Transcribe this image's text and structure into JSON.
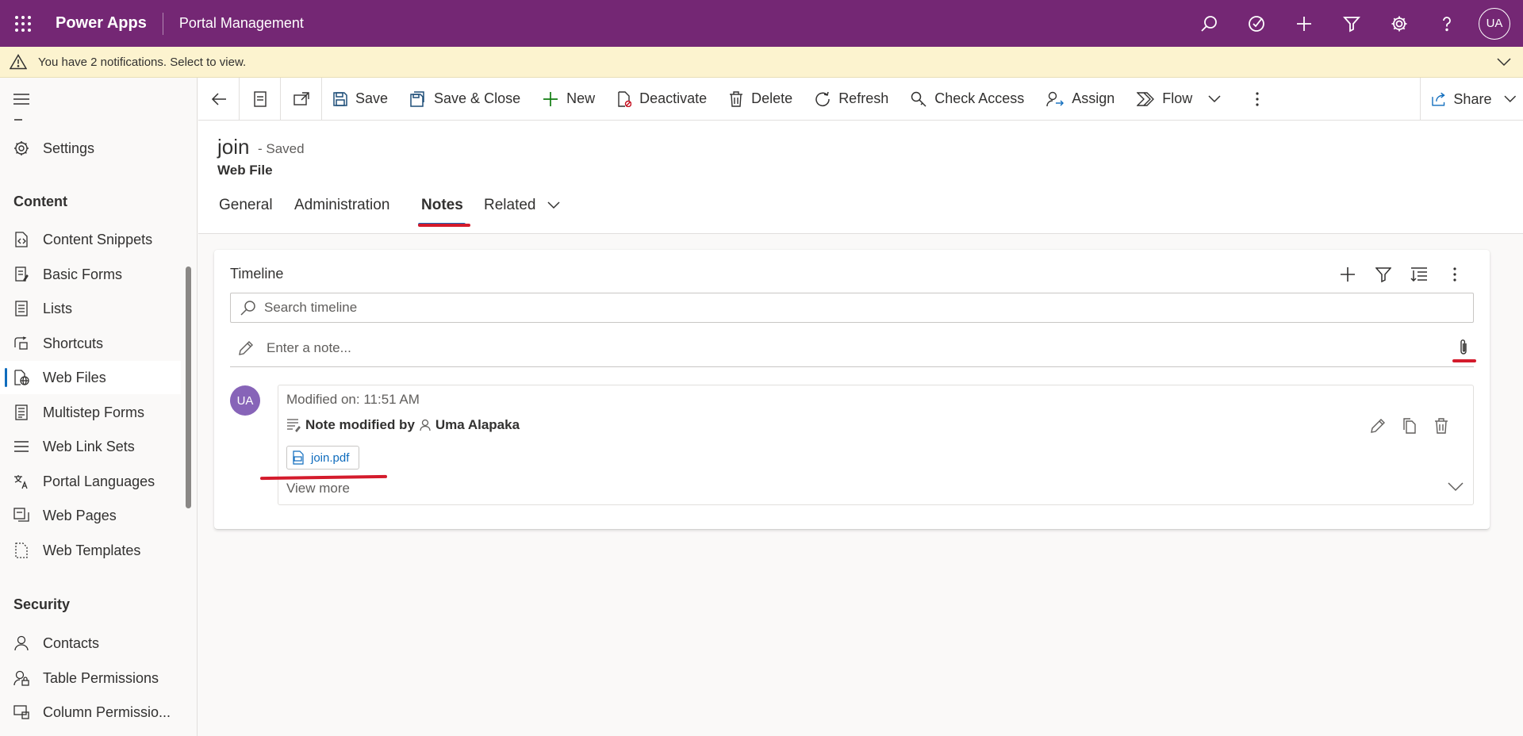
{
  "header": {
    "app_name": "Power Apps",
    "app_subtitle": "Portal Management",
    "user_initials": "UA",
    "icons": [
      "search-icon",
      "task-icon",
      "add-icon",
      "filter-icon",
      "settings-icon",
      "help-icon"
    ]
  },
  "notification": {
    "text": "You have 2 notifications. Select to view."
  },
  "sidebar": {
    "settings_label": "Settings",
    "content_header": "Content",
    "content_items": [
      {
        "label": "Content Snippets",
        "icon": "snippet-icon"
      },
      {
        "label": "Basic Forms",
        "icon": "form-icon"
      },
      {
        "label": "Lists",
        "icon": "list-icon"
      },
      {
        "label": "Shortcuts",
        "icon": "shortcut-icon"
      },
      {
        "label": "Web Files",
        "icon": "web-file-icon",
        "active": true
      },
      {
        "label": "Multistep Forms",
        "icon": "multistep-form-icon"
      },
      {
        "label": "Web Link Sets",
        "icon": "link-set-icon"
      },
      {
        "label": "Portal Languages",
        "icon": "language-icon"
      },
      {
        "label": "Web Pages",
        "icon": "web-page-icon"
      },
      {
        "label": "Web Templates",
        "icon": "template-icon"
      }
    ],
    "security_header": "Security",
    "security_items": [
      {
        "label": "Contacts",
        "icon": "contact-icon"
      },
      {
        "label": "Table Permissions",
        "icon": "table-permission-icon"
      },
      {
        "label": "Column Permissio...",
        "icon": "column-permission-icon"
      }
    ]
  },
  "commandbar": {
    "save": "Save",
    "save_close": "Save & Close",
    "new": "New",
    "deactivate": "Deactivate",
    "delete": "Delete",
    "refresh": "Refresh",
    "check_access": "Check Access",
    "assign": "Assign",
    "flow": "Flow",
    "share": "Share"
  },
  "record": {
    "title": "join",
    "status": "- Saved",
    "entity": "Web File"
  },
  "tabs": [
    "General",
    "Administration",
    "Notes",
    "Related"
  ],
  "active_tab": "Notes",
  "timeline": {
    "title": "Timeline",
    "search_placeholder": "Search timeline",
    "note_placeholder": "Enter a note...",
    "entry": {
      "avatar": "UA",
      "modified_on": "Modified on: 11:51 AM",
      "note_prefix": "Note modified by",
      "author": "Uma Alapaka",
      "attachment": "join.pdf",
      "view_more": "View more"
    }
  },
  "colors": {
    "header_bg": "#742774",
    "notification_bg": "#fcf3cf",
    "accent": "#0f6cbd",
    "avatar_bg": "#8764b8",
    "annotation_red": "#d41b2c"
  }
}
